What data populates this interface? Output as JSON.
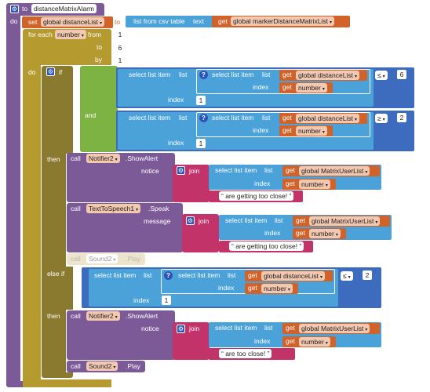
{
  "procedure": {
    "to": "to",
    "name": "distanceMatrixAlarm",
    "do": "do"
  },
  "set_block": {
    "set": "set",
    "var": "global distanceList",
    "to": "to",
    "list_from_csv": "list from csv table",
    "text": "text",
    "get": "get",
    "source": "global markerDistanceMatrixList"
  },
  "for_each": {
    "label": "for each",
    "var": "number",
    "from": "from",
    "from_val": "1",
    "to": "to",
    "to_val": "6",
    "by": "by",
    "by_val": "1",
    "do": "do"
  },
  "if_block": {
    "if": "if",
    "and": "and",
    "then": "then",
    "else_if": "else if"
  },
  "select": {
    "label": "select list item",
    "list": "list",
    "index": "index",
    "get": "get",
    "distance_list": "global distanceList",
    "number": "number",
    "one": "1",
    "user_list": "global MatrixUserList"
  },
  "compare": {
    "le": "≤",
    "ge": "≥",
    "six": "6",
    "two": "2"
  },
  "calls": {
    "call": "call",
    "notifier": "Notifier2",
    "show_alert": ".ShowAlert",
    "notice": "notice",
    "tts": "TextToSpeech1",
    "speak": ".Speak",
    "message": "message",
    "sound": "Sound2",
    "play": ".Play",
    "join": "join",
    "too_close_1": "are getting too close!",
    "too_close_2": "are getting too close!",
    "too_close_3": "are  too close!"
  }
}
